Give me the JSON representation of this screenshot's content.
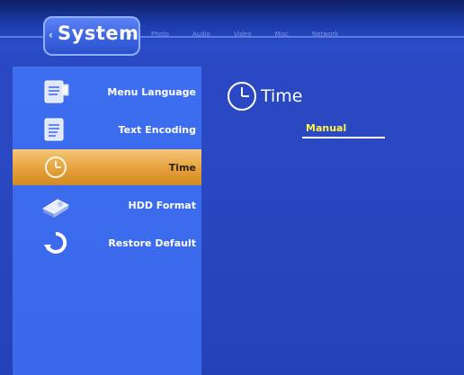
{
  "header": {
    "active_tab": "System",
    "tabs": [
      "Photo",
      "Audio",
      "Video",
      "Misc",
      "Network"
    ]
  },
  "sidebar": {
    "items": [
      {
        "label": "Menu Language",
        "icon": "document-flag-icon"
      },
      {
        "label": "Text Encoding",
        "icon": "document-icon"
      },
      {
        "label": "Time",
        "icon": "clock-icon",
        "selected": true
      },
      {
        "label": "HDD Format",
        "icon": "hard-drive-icon"
      },
      {
        "label": "Restore Default",
        "icon": "restore-arrow-icon"
      }
    ]
  },
  "panel": {
    "title": "Time",
    "value": "Manual"
  },
  "colors": {
    "background": "#2a48c2",
    "sidebar": "#3c6bed",
    "selected": "#e6a13a",
    "value_text": "#fff24a"
  }
}
